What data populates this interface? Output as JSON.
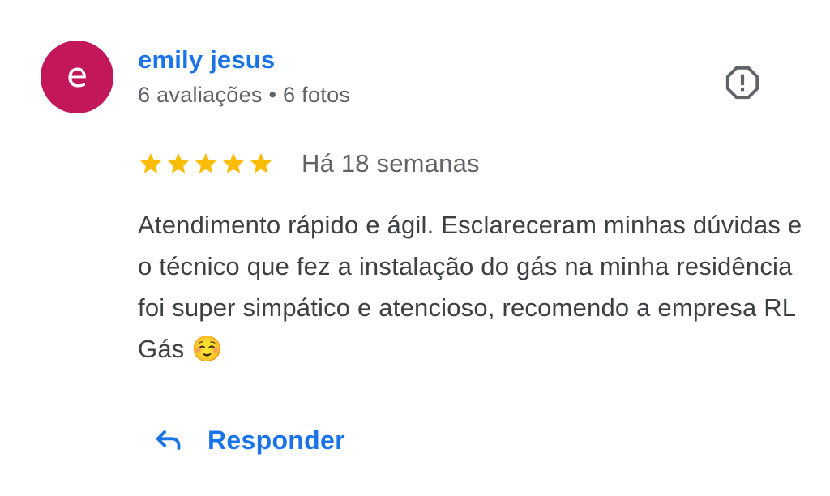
{
  "reviewer": {
    "avatar_letter": "e",
    "avatar_color": "#c2185b",
    "name": "emily jesus",
    "meta": "6 avaliações • 6 fotos"
  },
  "review": {
    "rating": 5,
    "rating_max": 5,
    "date": "Há 18 semanas",
    "text": "Atendimento rápido e ágil. Esclareceram minhas dúvidas e o técnico que fez a instalação do gás na minha residência foi super simpático e atencioso, recomendo a empresa RL Gás ☺️"
  },
  "actions": {
    "reply_label": "Responder",
    "reply_icon": "reply-arrow-icon",
    "report_icon": "report-octagon-icon"
  },
  "colors": {
    "accent": "#1a73e8",
    "star": "#fbbc04",
    "text": "#3c4043",
    "secondary_text": "#5f6368",
    "icon": "#5f6368"
  }
}
